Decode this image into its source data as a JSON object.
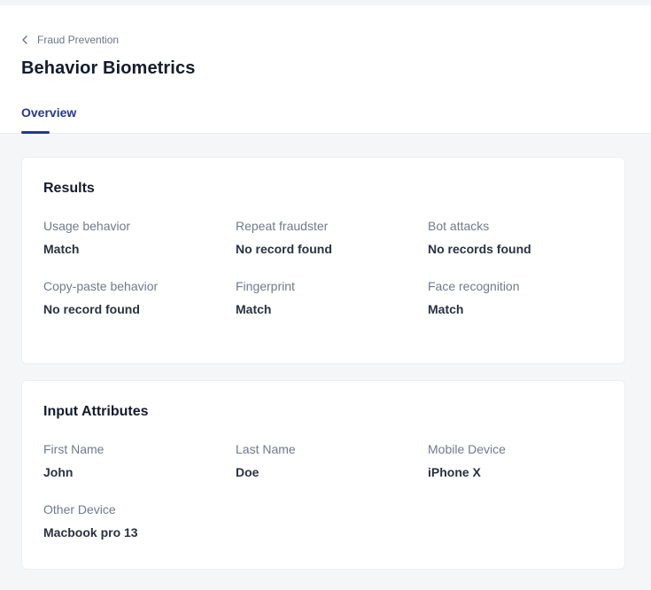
{
  "breadcrumb": {
    "label": "Fraud Prevention"
  },
  "page": {
    "title": "Behavior Biometrics"
  },
  "tabs": [
    {
      "label": "Overview",
      "active": true
    }
  ],
  "results": {
    "title": "Results",
    "fields": [
      {
        "label": "Usage behavior",
        "value": "Match"
      },
      {
        "label": "Repeat fraudster",
        "value": "No record found"
      },
      {
        "label": "Bot attacks",
        "value": "No records found"
      },
      {
        "label": "Copy-paste behavior",
        "value": "No record found"
      },
      {
        "label": "Fingerprint",
        "value": "Match"
      },
      {
        "label": "Face recognition",
        "value": "Match"
      }
    ]
  },
  "inputs": {
    "title": "Input Attributes",
    "fields": [
      {
        "label": "First Name",
        "value": "John"
      },
      {
        "label": "Last Name",
        "value": "Doe"
      },
      {
        "label": "Mobile Device",
        "value": "iPhone X"
      },
      {
        "label": "Other Device",
        "value": "Macbook pro 13"
      }
    ]
  },
  "colors": {
    "accent": "#26378d",
    "background": "#f5f6f8",
    "card": "#ffffff",
    "title_text": "#141b2d",
    "label_text": "#707a8c"
  },
  "icons": {
    "back": "chevron-left-icon"
  }
}
